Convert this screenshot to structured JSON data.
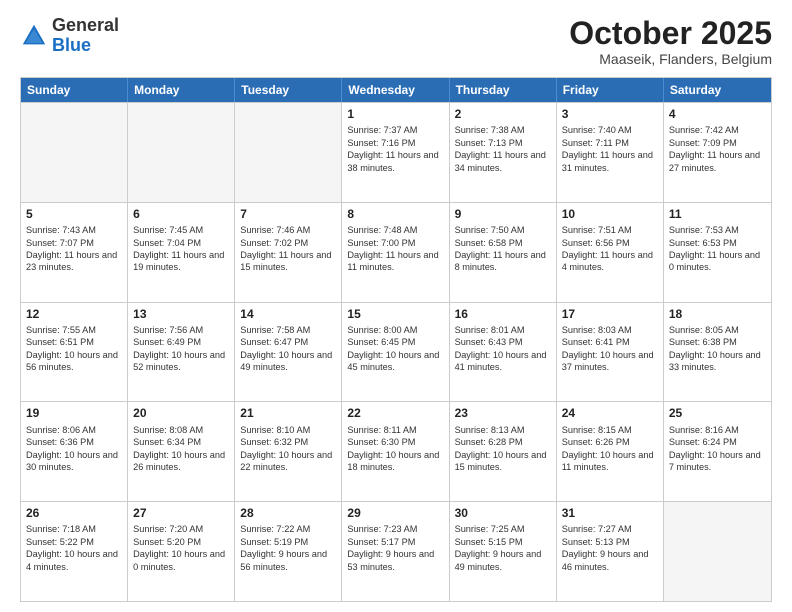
{
  "header": {
    "logo_general": "General",
    "logo_blue": "Blue",
    "month_title": "October 2025",
    "location": "Maaseik, Flanders, Belgium"
  },
  "days_of_week": [
    "Sunday",
    "Monday",
    "Tuesday",
    "Wednesday",
    "Thursday",
    "Friday",
    "Saturday"
  ],
  "weeks": [
    [
      {
        "day": "",
        "empty": true
      },
      {
        "day": "",
        "empty": true
      },
      {
        "day": "",
        "empty": true
      },
      {
        "day": "1",
        "sunrise": "7:37 AM",
        "sunset": "7:16 PM",
        "daylight": "11 hours and 38 minutes."
      },
      {
        "day": "2",
        "sunrise": "7:38 AM",
        "sunset": "7:13 PM",
        "daylight": "11 hours and 34 minutes."
      },
      {
        "day": "3",
        "sunrise": "7:40 AM",
        "sunset": "7:11 PM",
        "daylight": "11 hours and 31 minutes."
      },
      {
        "day": "4",
        "sunrise": "7:42 AM",
        "sunset": "7:09 PM",
        "daylight": "11 hours and 27 minutes."
      }
    ],
    [
      {
        "day": "5",
        "sunrise": "7:43 AM",
        "sunset": "7:07 PM",
        "daylight": "11 hours and 23 minutes."
      },
      {
        "day": "6",
        "sunrise": "7:45 AM",
        "sunset": "7:04 PM",
        "daylight": "11 hours and 19 minutes."
      },
      {
        "day": "7",
        "sunrise": "7:46 AM",
        "sunset": "7:02 PM",
        "daylight": "11 hours and 15 minutes."
      },
      {
        "day": "8",
        "sunrise": "7:48 AM",
        "sunset": "7:00 PM",
        "daylight": "11 hours and 11 minutes."
      },
      {
        "day": "9",
        "sunrise": "7:50 AM",
        "sunset": "6:58 PM",
        "daylight": "11 hours and 8 minutes."
      },
      {
        "day": "10",
        "sunrise": "7:51 AM",
        "sunset": "6:56 PM",
        "daylight": "11 hours and 4 minutes."
      },
      {
        "day": "11",
        "sunrise": "7:53 AM",
        "sunset": "6:53 PM",
        "daylight": "11 hours and 0 minutes."
      }
    ],
    [
      {
        "day": "12",
        "sunrise": "7:55 AM",
        "sunset": "6:51 PM",
        "daylight": "10 hours and 56 minutes."
      },
      {
        "day": "13",
        "sunrise": "7:56 AM",
        "sunset": "6:49 PM",
        "daylight": "10 hours and 52 minutes."
      },
      {
        "day": "14",
        "sunrise": "7:58 AM",
        "sunset": "6:47 PM",
        "daylight": "10 hours and 49 minutes."
      },
      {
        "day": "15",
        "sunrise": "8:00 AM",
        "sunset": "6:45 PM",
        "daylight": "10 hours and 45 minutes."
      },
      {
        "day": "16",
        "sunrise": "8:01 AM",
        "sunset": "6:43 PM",
        "daylight": "10 hours and 41 minutes."
      },
      {
        "day": "17",
        "sunrise": "8:03 AM",
        "sunset": "6:41 PM",
        "daylight": "10 hours and 37 minutes."
      },
      {
        "day": "18",
        "sunrise": "8:05 AM",
        "sunset": "6:38 PM",
        "daylight": "10 hours and 33 minutes."
      }
    ],
    [
      {
        "day": "19",
        "sunrise": "8:06 AM",
        "sunset": "6:36 PM",
        "daylight": "10 hours and 30 minutes."
      },
      {
        "day": "20",
        "sunrise": "8:08 AM",
        "sunset": "6:34 PM",
        "daylight": "10 hours and 26 minutes."
      },
      {
        "day": "21",
        "sunrise": "8:10 AM",
        "sunset": "6:32 PM",
        "daylight": "10 hours and 22 minutes."
      },
      {
        "day": "22",
        "sunrise": "8:11 AM",
        "sunset": "6:30 PM",
        "daylight": "10 hours and 18 minutes."
      },
      {
        "day": "23",
        "sunrise": "8:13 AM",
        "sunset": "6:28 PM",
        "daylight": "10 hours and 15 minutes."
      },
      {
        "day": "24",
        "sunrise": "8:15 AM",
        "sunset": "6:26 PM",
        "daylight": "10 hours and 11 minutes."
      },
      {
        "day": "25",
        "sunrise": "8:16 AM",
        "sunset": "6:24 PM",
        "daylight": "10 hours and 7 minutes."
      }
    ],
    [
      {
        "day": "26",
        "sunrise": "7:18 AM",
        "sunset": "5:22 PM",
        "daylight": "10 hours and 4 minutes."
      },
      {
        "day": "27",
        "sunrise": "7:20 AM",
        "sunset": "5:20 PM",
        "daylight": "10 hours and 0 minutes."
      },
      {
        "day": "28",
        "sunrise": "7:22 AM",
        "sunset": "5:19 PM",
        "daylight": "9 hours and 56 minutes."
      },
      {
        "day": "29",
        "sunrise": "7:23 AM",
        "sunset": "5:17 PM",
        "daylight": "9 hours and 53 minutes."
      },
      {
        "day": "30",
        "sunrise": "7:25 AM",
        "sunset": "5:15 PM",
        "daylight": "9 hours and 49 minutes."
      },
      {
        "day": "31",
        "sunrise": "7:27 AM",
        "sunset": "5:13 PM",
        "daylight": "9 hours and 46 minutes."
      },
      {
        "day": "",
        "empty": true
      }
    ]
  ]
}
